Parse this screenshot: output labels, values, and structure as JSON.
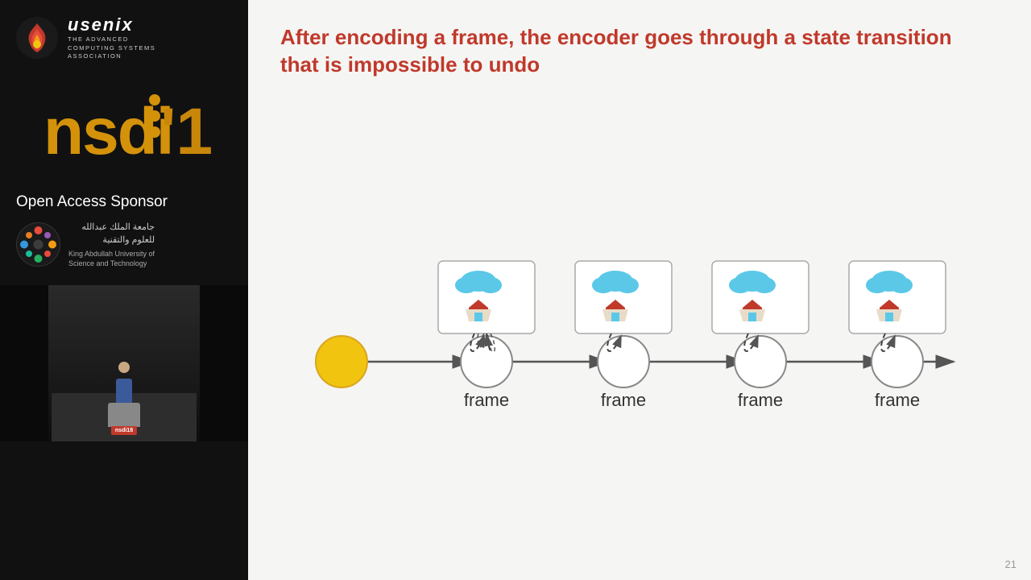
{
  "sidebar": {
    "usenix": {
      "name": "usenix",
      "subtitle_line1": "THE ADVANCED",
      "subtitle_line2": "COMPUTING SYSTEMS",
      "subtitle_line3": "ASSOCIATION"
    },
    "nsdi": {
      "year": "'18"
    },
    "open_access": {
      "title": "Open Access Sponsor",
      "sponsor_arabic_line1": "جامعة الملك عبدالله",
      "sponsor_arabic_line2": "للعلوم والتقنية",
      "sponsor_english_line1": "King Abdullah University of",
      "sponsor_english_line2": "Science and Technology"
    }
  },
  "slide": {
    "title": "After encoding a frame, the encoder goes through a state transition that is impossible to undo",
    "frame_label": "frame",
    "slide_number": "21"
  }
}
